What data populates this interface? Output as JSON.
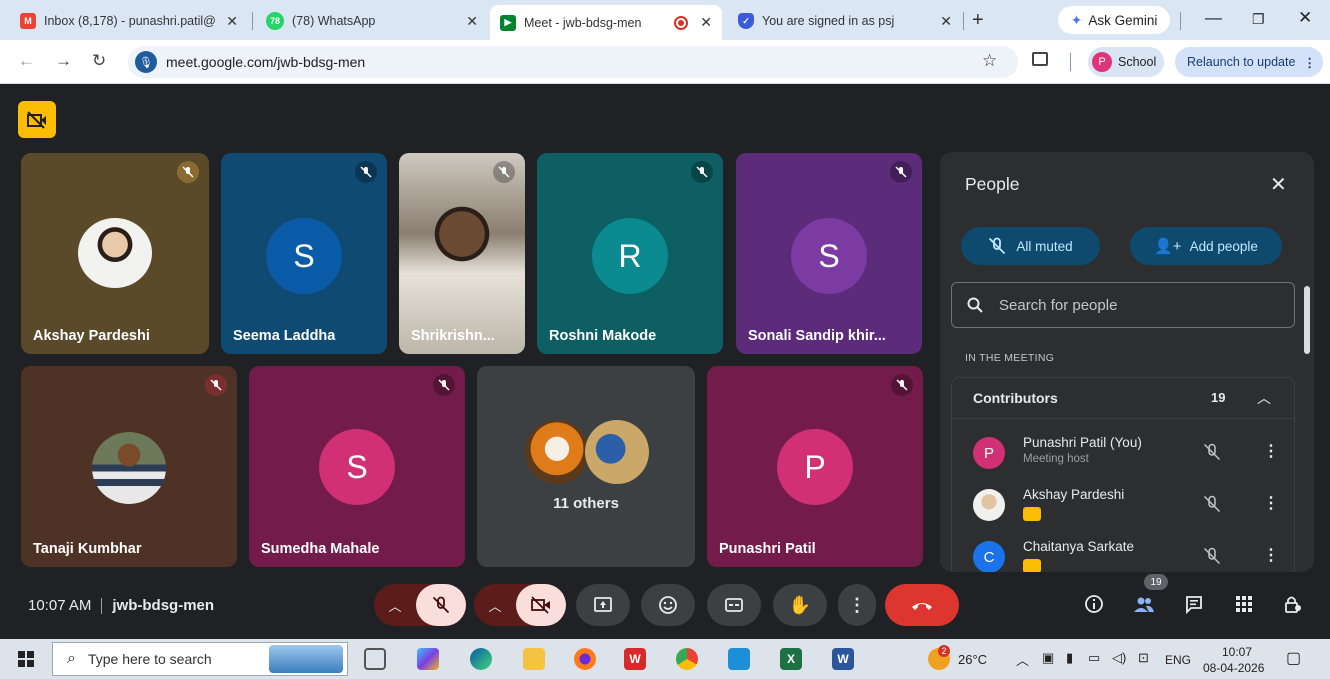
{
  "browser": {
    "tabs": [
      {
        "title": "Inbox (8,178) - punashri.patil@",
        "icon": "gmail-icon",
        "color": "#ea4335"
      },
      {
        "title": "(78) WhatsApp",
        "badge": "78",
        "icon": "whatsapp-icon",
        "color": "#25d366"
      },
      {
        "title": "Meet - jwb-bdsg-men",
        "icon": "meet-icon",
        "color": "#00832d"
      },
      {
        "title": "You are signed in as psj",
        "icon": "shield-icon",
        "color": "#3b5bdb"
      }
    ],
    "gemini_label": "Ask Gemini",
    "url": "meet.google.com/jwb-bdsg-men",
    "profile_initial": "P",
    "profile_label": "School",
    "relaunch_label": "Relaunch to update"
  },
  "tiles": [
    {
      "name": "Akshay Pardeshi",
      "bg": "#5a4a2a"
    },
    {
      "name": "Seema Laddha",
      "initial": "S",
      "bg": "#0f4a73",
      "avatar_bg": "#0b5ca8"
    },
    {
      "name": "Shrikrishn...",
      "bg": "#8a7e6f"
    },
    {
      "name": "Roshni Makode",
      "initial": "R",
      "bg": "#0d5f63",
      "avatar_bg": "#0b8a90"
    },
    {
      "name": "Sonali Sandip khir...",
      "initial": "S",
      "bg": "#5c2b7a",
      "avatar_bg": "#7c3aa3"
    },
    {
      "name": "Tanaji Kumbhar",
      "bg": "#4e3226"
    },
    {
      "name": "Sumedha Mahale",
      "initial": "S",
      "bg": "#731c4b",
      "avatar_bg": "#d23074"
    },
    {
      "name": "11 others",
      "bg": "#3c4043"
    },
    {
      "name": "Punashri Patil",
      "initial": "P",
      "bg": "#731c4b",
      "avatar_bg": "#d23074"
    }
  ],
  "people_panel": {
    "title": "People",
    "all_muted": "All muted",
    "add_people": "Add people",
    "search_placeholder": "Search for people",
    "section": "IN THE MEETING",
    "group_label": "Contributors",
    "group_count": "19",
    "participants": [
      {
        "name": "Punashri Patil (You)",
        "role": "Meeting host",
        "initial": "P",
        "color": "#d23074"
      },
      {
        "name": "Akshay Pardeshi",
        "role": "",
        "initial": "",
        "color": "#c8b9a6"
      },
      {
        "name": "Chaitanya Sarkate",
        "role": "",
        "initial": "C",
        "color": "#1a73e8"
      }
    ]
  },
  "meeting": {
    "time": "10:07 AM",
    "code": "jwb-bdsg-men",
    "participants_badge": "19"
  },
  "taskbar": {
    "search_placeholder": "Type here to search",
    "weather_badge": "2",
    "temperature": "26°C",
    "language": "ENG",
    "time": "10:07",
    "date": "08-04-2026"
  }
}
